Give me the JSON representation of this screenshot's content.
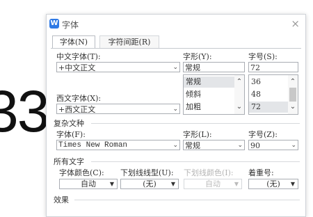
{
  "background_text": "33",
  "dialog": {
    "title": "字体",
    "app_icon_letter": "W",
    "close_glyph": "×",
    "tabs": [
      {
        "label": "字体(N)"
      },
      {
        "label": "字符间距(R)"
      }
    ]
  },
  "chinese_font": {
    "label": "中文字体(T):",
    "value": "+中文正文"
  },
  "style": {
    "label": "字形(Y):",
    "value": "常规",
    "options": [
      "常规",
      "倾斜",
      "加粗"
    ]
  },
  "size": {
    "label": "字号(S):",
    "value": "72",
    "options": [
      "36",
      "48",
      "72"
    ]
  },
  "western_font": {
    "label": "西文字体(X):",
    "value": "+西文正文"
  },
  "complex": {
    "section_title": "复杂文种",
    "font_label": "字体(F):",
    "font_value": "Times New Roman",
    "style_label": "字形(L):",
    "style_value": "常规",
    "size_label": "字号(Z):",
    "size_value": "90"
  },
  "all_text": {
    "section_title": "所有文字",
    "font_color_label": "字体颜色(C):",
    "font_color_value": "自动",
    "underline_label": "下划线线型(U):",
    "underline_value": "(无)",
    "underline_color_label": "下划线颜色(I):",
    "underline_color_value": "自动",
    "emphasis_label": "着重号:",
    "emphasis_value": "(无)"
  },
  "effects": {
    "section_title": "效果"
  },
  "colors": {
    "accent": "#2f7ae5",
    "selection": "#e3e5e8",
    "border": "#a9adb3"
  }
}
